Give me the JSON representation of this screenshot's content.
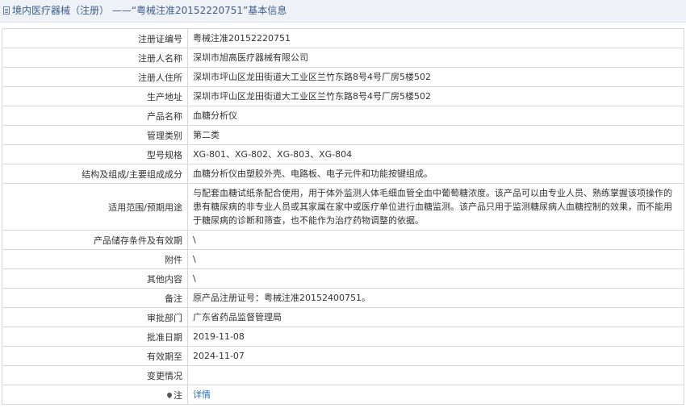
{
  "header": {
    "title": "境内医疗器械（注册） ——“粤械注准20152220751”基本信息"
  },
  "rows": [
    {
      "label": "注册证编号",
      "value": "粤械注准20152220751"
    },
    {
      "label": "注册人名称",
      "value": "深圳市旭高医疗器械有限公司"
    },
    {
      "label": "注册人住所",
      "value": "深圳市坪山区龙田街道大工业区兰竹东路8号4号厂房5楼502"
    },
    {
      "label": "生产地址",
      "value": "深圳市坪山区龙田街道大工业区兰竹东路8号4号厂房5楼502"
    },
    {
      "label": "产品名称",
      "value": "血糖分析仪"
    },
    {
      "label": "管理类别",
      "value": "第二类"
    },
    {
      "label": "型号规格",
      "value": "XG-801、XG-802、XG-803、XG-804"
    },
    {
      "label": "结构及组成/主要组成成分",
      "value": "血糖分析仪由塑胶外壳、电路板、电子元件和功能按键组成。"
    },
    {
      "label": "适用范围/预期用途",
      "value": "与配套血糖试纸条配合使用，用于体外监测人体毛细血管全血中葡萄糖浓度。该产品可以由专业人员、熟练掌握该项操作的患有糖尿病的非专业人员或其家属在家中或医疗单位进行血糖监测。该产品只用于监测糖尿病人血糖控制的效果，而不能用于糖尿病的诊断和筛查，也不能作为治疗药物调整的依据。"
    },
    {
      "label": "产品储存条件及有效期",
      "value": "\\"
    },
    {
      "label": "附件",
      "value": "\\"
    },
    {
      "label": "其他内容",
      "value": "\\"
    },
    {
      "label": "备注",
      "value": "原产品注册证号：粤械注准20152400751。"
    },
    {
      "label": "审批部门",
      "value": "广东省药品监督管理局"
    },
    {
      "label": "批准日期",
      "value": "2019-11-08"
    },
    {
      "label": "有效期至",
      "value": "2024-11-07"
    },
    {
      "label": "变更情况",
      "value": ""
    }
  ],
  "note_row": {
    "label": "注",
    "link": "详情"
  }
}
